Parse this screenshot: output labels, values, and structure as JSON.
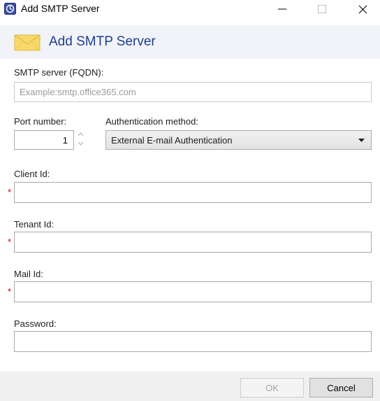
{
  "window": {
    "title": "Add SMTP Server",
    "icon": "app-shield-icon"
  },
  "header": {
    "title": "Add SMTP Server",
    "icon": "envelope-icon"
  },
  "form": {
    "smtp_server": {
      "label": "SMTP server (FQDN):",
      "placeholder": "Example:smtp.office365.com",
      "value": ""
    },
    "port": {
      "label": "Port number:",
      "value": "1"
    },
    "auth_method": {
      "label": "Authentication method:",
      "selected": "External E-mail Authentication"
    },
    "client_id": {
      "label": "Client Id:",
      "value": "",
      "required": true
    },
    "tenant_id": {
      "label": "Tenant Id:",
      "value": "",
      "required": true
    },
    "mail_id": {
      "label": "Mail Id:",
      "value": "",
      "required": true
    },
    "password": {
      "label": "Password:",
      "value": ""
    },
    "required_marker": "*"
  },
  "footer": {
    "ok_label": "OK",
    "cancel_label": "Cancel",
    "ok_enabled": false
  },
  "colors": {
    "header_title": "#1f3e8c",
    "header_band": "#f1f3f8",
    "required": "#d20000",
    "footer": "#f0f0f0"
  }
}
